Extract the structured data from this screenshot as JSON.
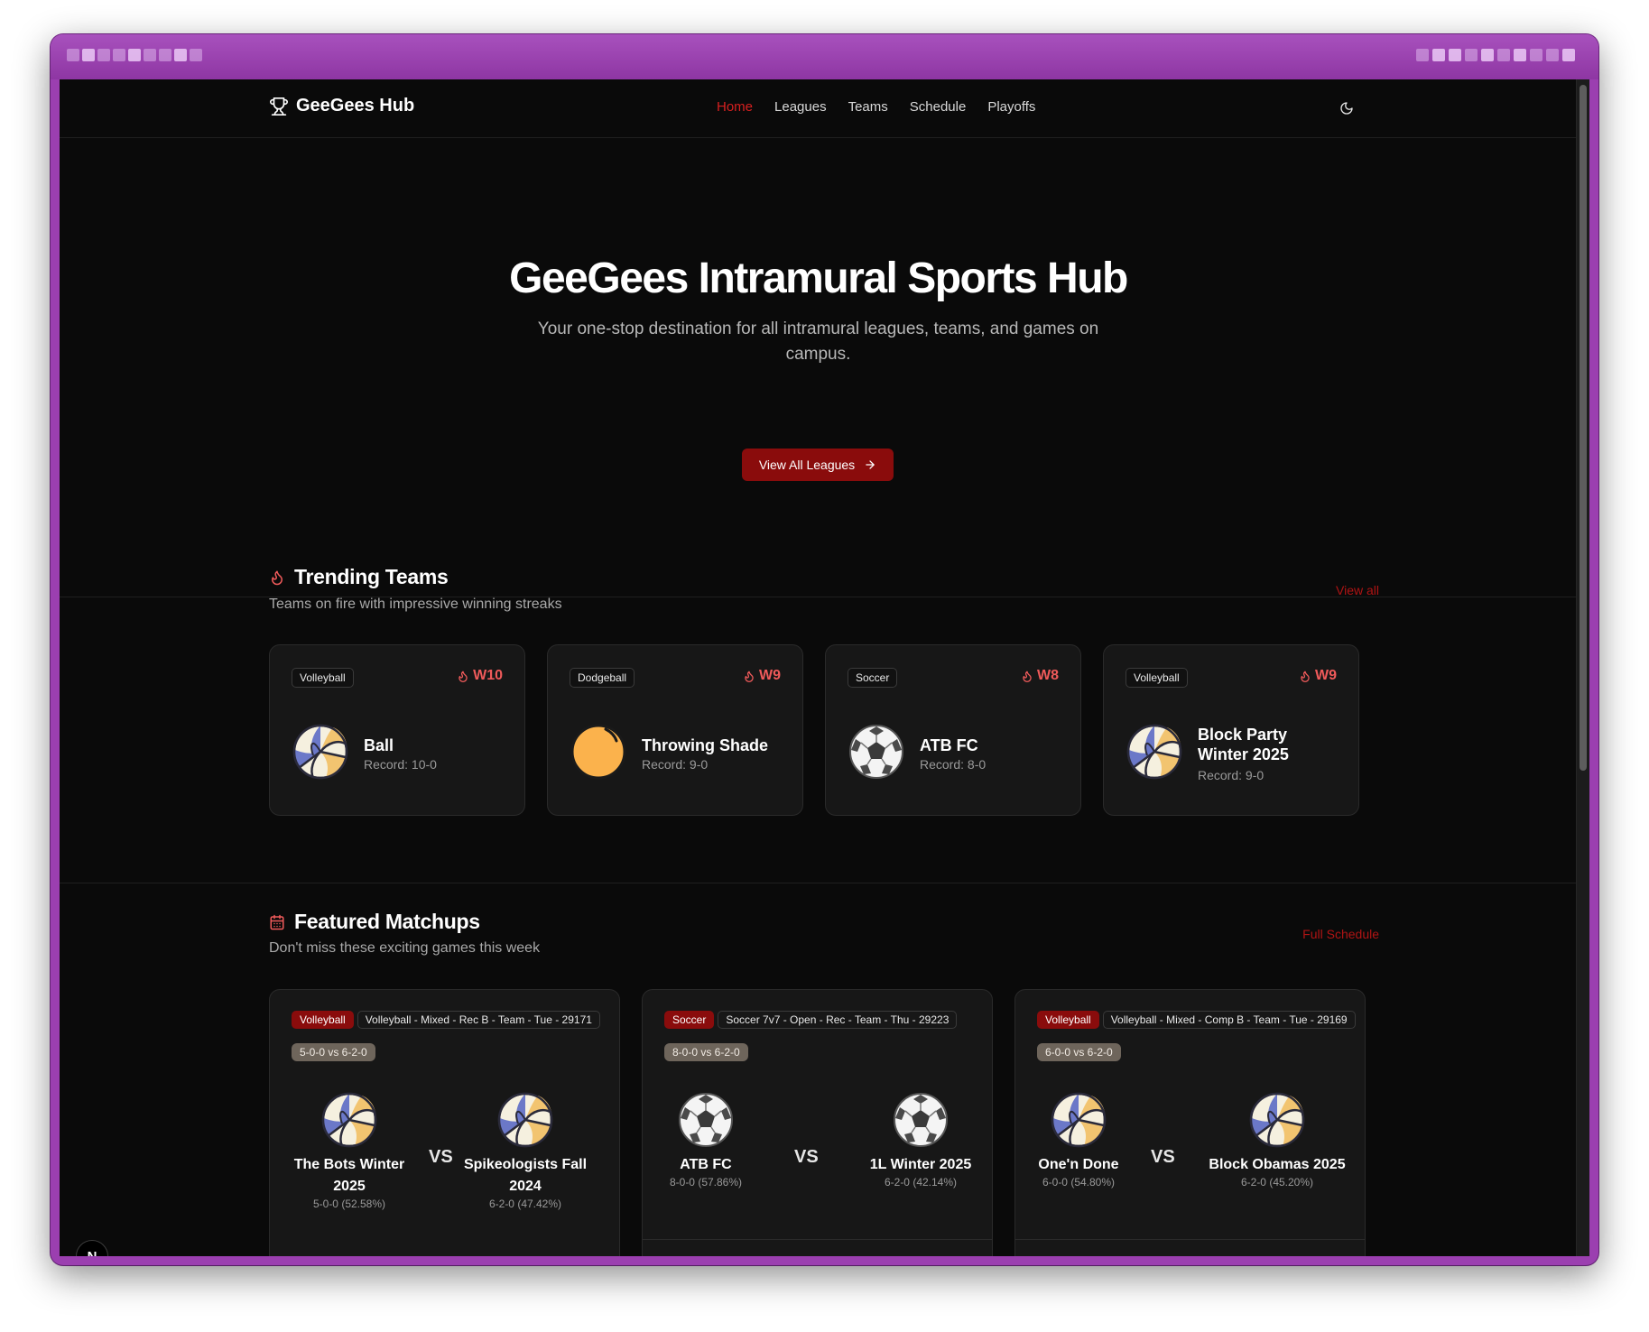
{
  "nav": {
    "brand": "GeeGees Hub",
    "links": [
      {
        "label": "Home",
        "active": true
      },
      {
        "label": "Leagues",
        "active": false
      },
      {
        "label": "Teams",
        "active": false
      },
      {
        "label": "Schedule",
        "active": false
      },
      {
        "label": "Playoffs",
        "active": false
      }
    ]
  },
  "hero": {
    "title": "GeeGees Intramural Sports Hub",
    "subtitle": "Your one-stop destination for all intramural leagues, teams, and games on campus.",
    "cta": "View All Leagues"
  },
  "trending": {
    "title": "Trending Teams",
    "subtitle": "Teams on fire with impressive winning streaks",
    "link": "View all",
    "teams": [
      {
        "sport": "Volleyball",
        "streak": "W10",
        "name": "Ball",
        "record": "Record: 10-0",
        "icon": "volleyball-icon"
      },
      {
        "sport": "Dodgeball",
        "streak": "W9",
        "name": "Throwing Shade",
        "record": "Record: 9-0",
        "icon": "dodgeball-icon"
      },
      {
        "sport": "Soccer",
        "streak": "W8",
        "name": "ATB FC",
        "record": "Record: 8-0",
        "icon": "soccer-ball-icon"
      },
      {
        "sport": "Volleyball",
        "streak": "W9",
        "name_line1": "Block Party",
        "name_line2": "Winter 2025",
        "record": "Record: 9-0",
        "icon": "volleyball-icon"
      }
    ]
  },
  "featured": {
    "title": "Featured Matchups",
    "subtitle": "Don't miss these exciting games this week",
    "link": "Full Schedule",
    "vs_label": "VS",
    "matchups": [
      {
        "sport": "Volleyball",
        "league": "Volleyball - Mixed - Rec B - Team - Tue - 29171",
        "records": "5-0-0 vs 6-2-0",
        "home": {
          "name_line1": "The Bots Winter",
          "name_line2": "2025",
          "record": "5-0-0 (52.58%)"
        },
        "away": {
          "name_line1": "Spikeologists Fall",
          "name_line2": "2024",
          "record": "6-2-0 (47.42%)"
        }
      },
      {
        "sport": "Soccer",
        "league": "Soccer 7v7 - Open - Rec - Team - Thu - 29223",
        "records": "8-0-0 vs 6-2-0",
        "home": {
          "name_line1": "ATB FC",
          "record": "8-0-0 (57.86%)"
        },
        "away": {
          "name_line1": "1L Winter 2025",
          "record": "6-2-0 (42.14%)"
        }
      },
      {
        "sport": "Volleyball",
        "league": "Volleyball - Mixed - Comp B - Team - Tue - 29169",
        "records": "6-0-0 vs 6-2-0",
        "home": {
          "name_line1": "One'n Done",
          "record": "6-0-0 (54.80%)"
        },
        "away": {
          "name_line1": "Block Obamas 2025",
          "record": "6-2-0 (45.20%)"
        }
      }
    ]
  },
  "dev_badge": "N",
  "colors": {
    "accent": "#d62020",
    "button": "#8a0c0c",
    "streak": "#ef5a5a",
    "background": "#0a0a0a",
    "card": "#171717",
    "frame": "#9b3fb0"
  }
}
